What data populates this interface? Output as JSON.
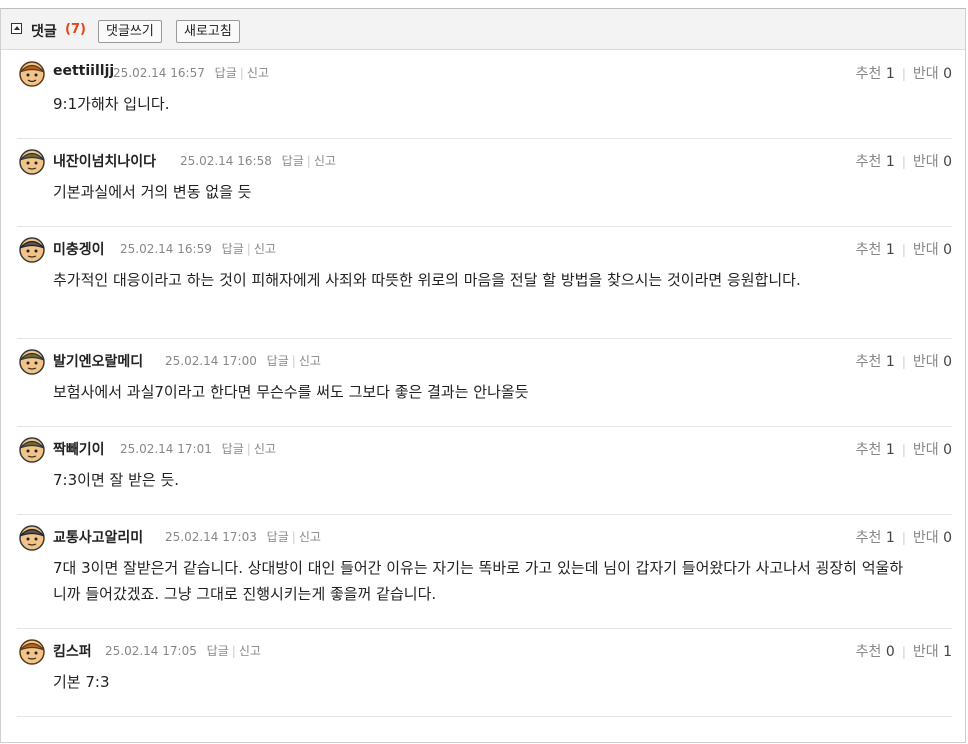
{
  "header": {
    "title": "댓글",
    "count": "(7)",
    "write_label": "댓글쓰기",
    "refresh_label": "새로고침"
  },
  "comments": [
    {
      "nick": "eettiilljj",
      "date": "25.02.14 16:57",
      "reply": "답글",
      "report": "신고",
      "up_label": "추천",
      "up": "1",
      "down_label": "반대",
      "down": "0",
      "text": "9:1가해차 입니다."
    },
    {
      "nick": "내잔이넘치나이다",
      "date": "25.02.14 16:58",
      "reply": "답글",
      "report": "신고",
      "up_label": "추천",
      "up": "1",
      "down_label": "반대",
      "down": "0",
      "text": "기본과실에서 거의 변동 없을 듯"
    },
    {
      "nick": "미충겡이",
      "date": "25.02.14 16:59",
      "reply": "답글",
      "report": "신고",
      "up_label": "추천",
      "up": "1",
      "down_label": "반대",
      "down": "0",
      "text": "추가적인 대응이라고 하는 것이 피해자에게 사죄와 따뜻한 위로의 마음을 전달 할 방법을 찾으시는 것이라면 응원합니다."
    },
    {
      "nick": "발기엔오랄메디",
      "date": "25.02.14 17:00",
      "reply": "답글",
      "report": "신고",
      "up_label": "추천",
      "up": "1",
      "down_label": "반대",
      "down": "0",
      "text": "보험사에서 과실7이라고 한다면 무슨수를 써도 그보다 좋은 결과는 안나올듯"
    },
    {
      "nick": "짝빼기이",
      "date": "25.02.14 17:01",
      "reply": "답글",
      "report": "신고",
      "up_label": "추천",
      "up": "1",
      "down_label": "반대",
      "down": "0",
      "text": "7:3이면 잘 받은 듯."
    },
    {
      "nick": "교통사고알리미",
      "date": "25.02.14 17:03",
      "reply": "답글",
      "report": "신고",
      "up_label": "추천",
      "up": "1",
      "down_label": "반대",
      "down": "0",
      "text": "7대 3이면 잘받은거 같습니다. 상대방이 대인 들어간 이유는 자기는 똑바로 가고 있는데 님이 갑자기 들어왔다가 사고나서 굉장히 억울하니까 들어갔겠죠. 그냥 그대로 진행시키는게 좋을꺼 같습니다."
    },
    {
      "nick": "킴스퍼",
      "date": "25.02.14 17:05",
      "reply": "답글",
      "report": "신고",
      "up_label": "추천",
      "up": "0",
      "down_label": "반대",
      "down": "1",
      "text": "기본 7:3"
    }
  ]
}
